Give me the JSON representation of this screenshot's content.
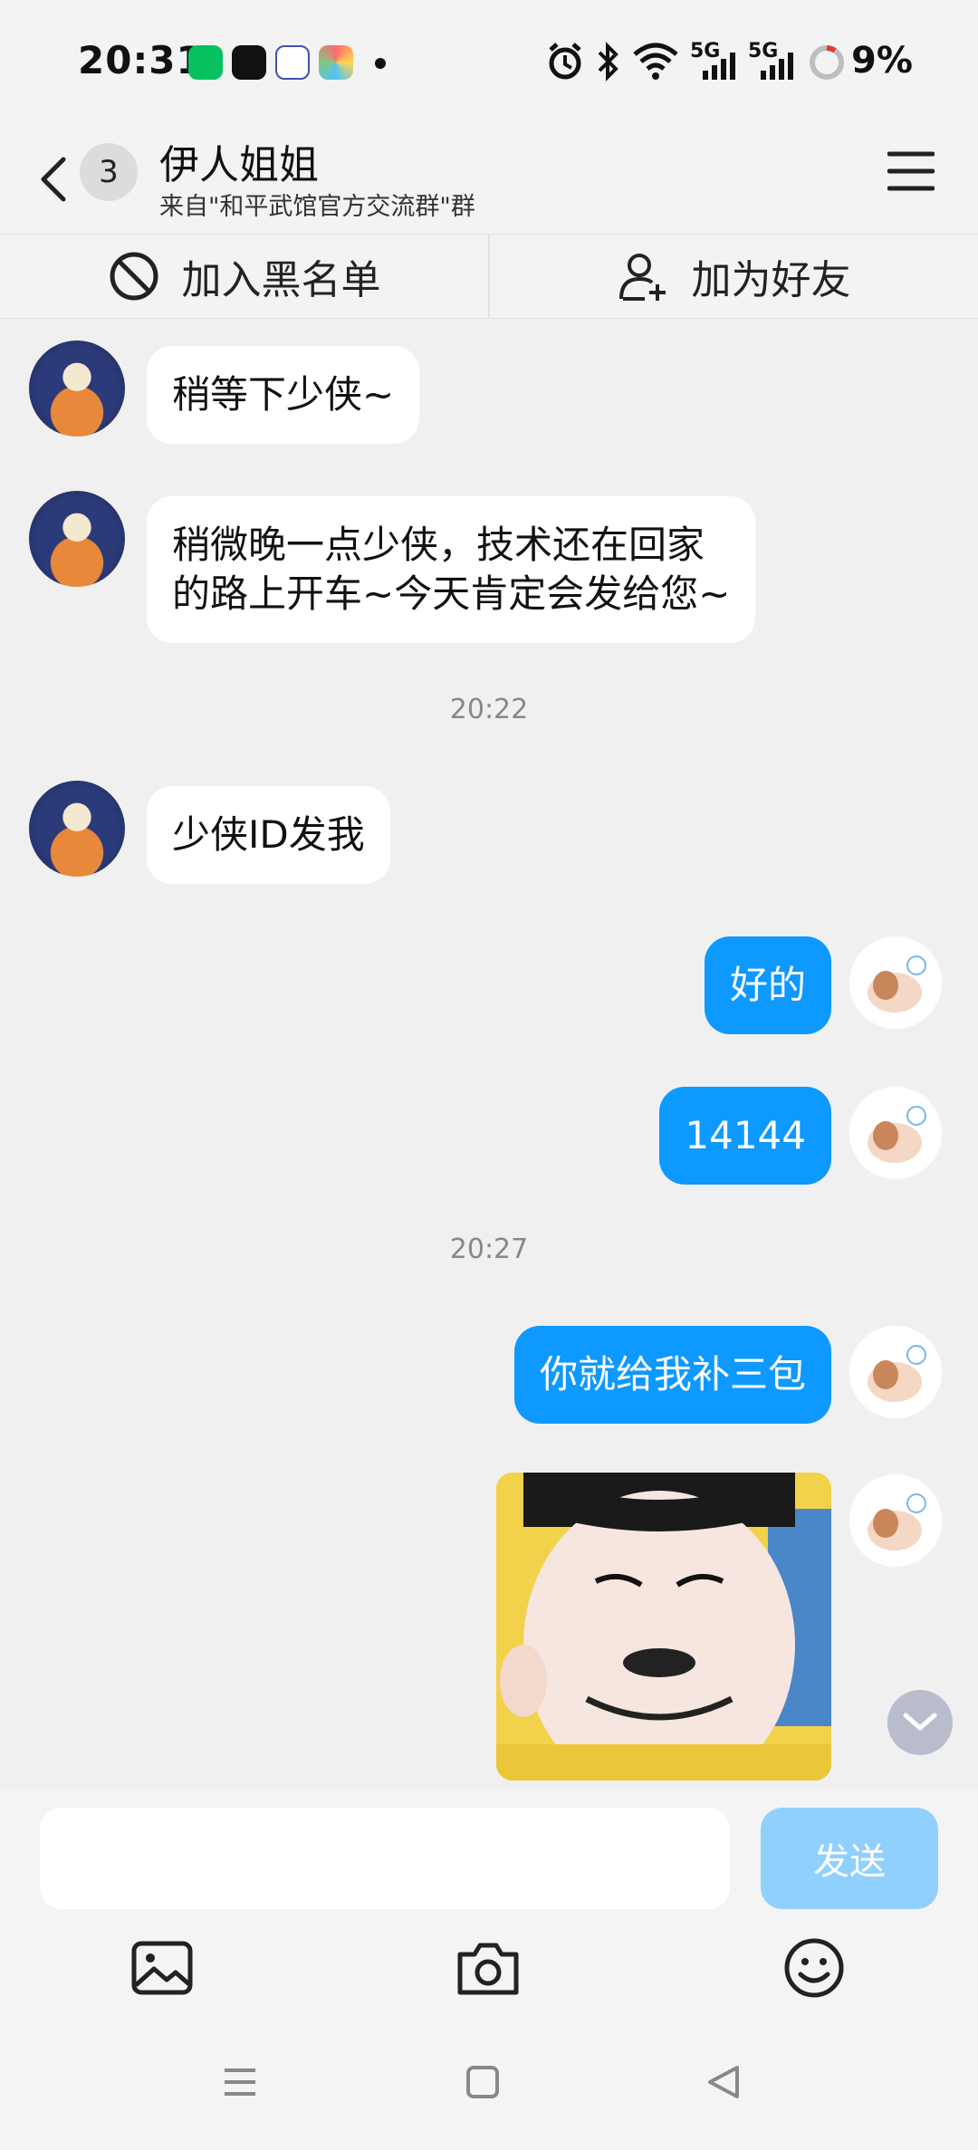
{
  "status_bar": {
    "time": "20:31",
    "network_1": "5G",
    "network_2": "5G",
    "battery": "9%",
    "icons": [
      "wechat-icon",
      "tiktok-icon",
      "tieba-icon",
      "app-icon",
      "alarm-icon",
      "bluetooth-icon",
      "wifi-icon",
      "signal-icon",
      "signal-icon",
      "battery-ring-icon"
    ]
  },
  "header": {
    "unread_count": "3",
    "title": "伊人姐姐",
    "subtitle": "来自\"和平武馆官方交流群\"群"
  },
  "actions": {
    "blacklist_label": "加入黑名单",
    "add_friend_label": "加为好友"
  },
  "messages": [
    {
      "sender": "other",
      "text": "稍等下少侠~"
    },
    {
      "sender": "other",
      "text": "稍微晚一点少侠，技术还在回家\n的路上开车~今天肯定会发给您~"
    },
    {
      "type": "timestamp",
      "text": "20:22"
    },
    {
      "sender": "other",
      "text": "少侠ID发我"
    },
    {
      "sender": "self",
      "text": "好的"
    },
    {
      "sender": "self",
      "text": "14144"
    },
    {
      "type": "timestamp",
      "text": "20:27"
    },
    {
      "sender": "self",
      "text": "你就给我补三包"
    },
    {
      "sender": "self",
      "type": "image",
      "image": "meme-face-image"
    }
  ],
  "input": {
    "value": "",
    "placeholder": "",
    "send_label": "发送"
  },
  "colors": {
    "self_bubble": "#0d99ff",
    "send_button_disabled": "#8fd0ff",
    "background": "#f0f0f0"
  }
}
